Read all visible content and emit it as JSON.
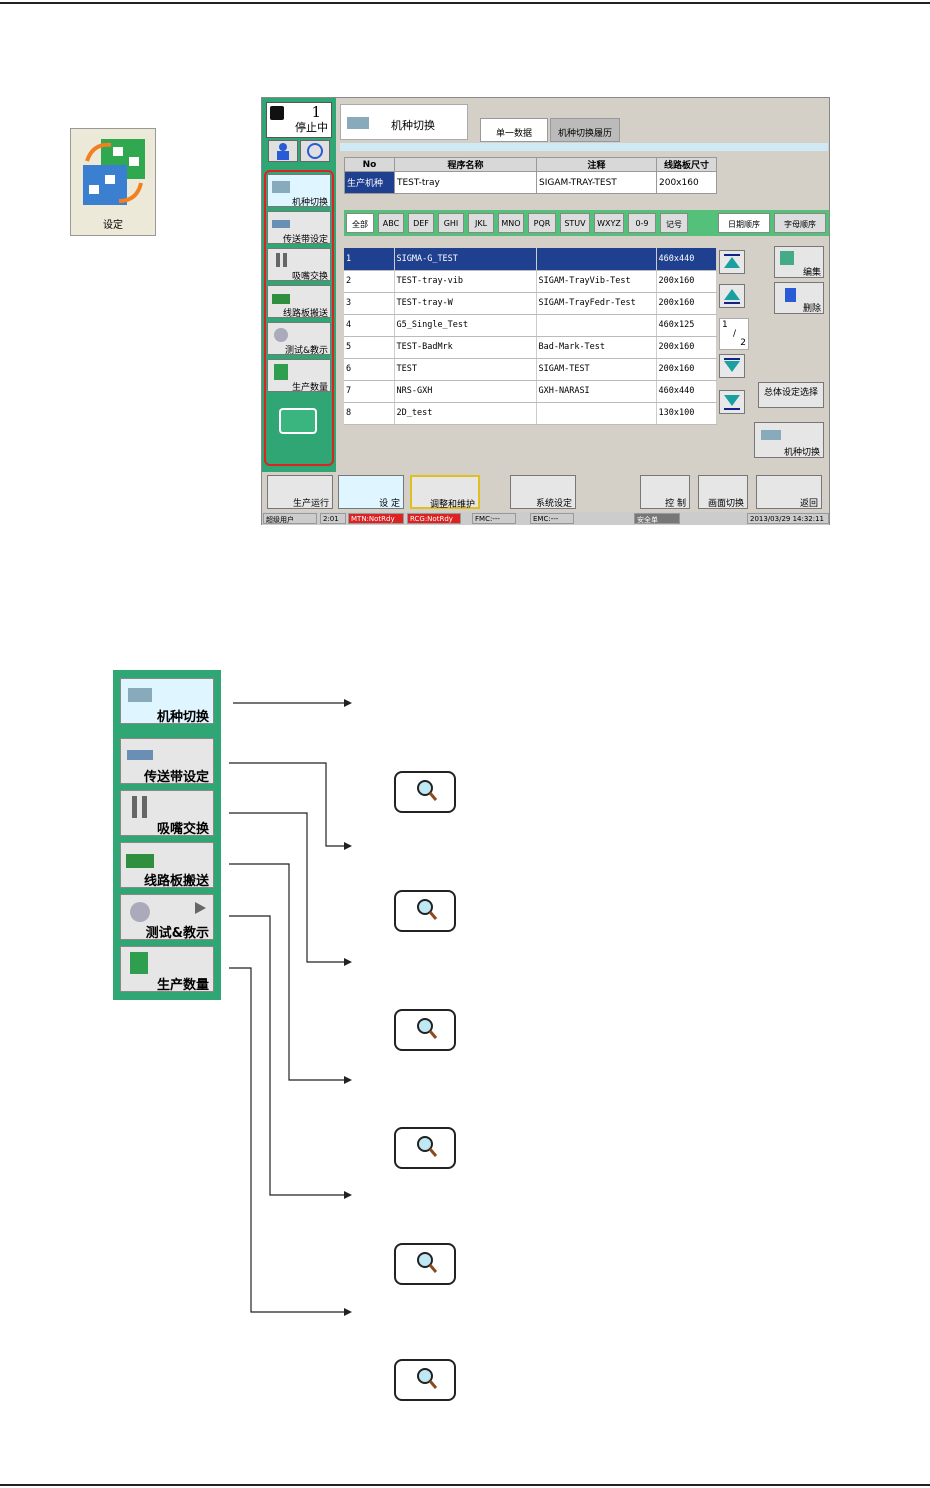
{
  "settings_icon": {
    "label": "设定"
  },
  "screen": {
    "status": {
      "count": "1",
      "text": "停止中"
    },
    "title": "机种切换",
    "tabs": [
      "单一数据",
      "机种切换履历"
    ],
    "sidebar": [
      "机种切换",
      "传送带设定",
      "吸嘴交换",
      "线路板搬送",
      "测试&教示",
      "生产数量"
    ],
    "header_table": {
      "columns": [
        "No",
        "程序名称",
        "注释",
        "线路板尺寸"
      ],
      "row": [
        "生产机种",
        "TEST-tray",
        "SIGAM-TRAY-TEST",
        "200x160"
      ]
    },
    "filters": [
      "全部",
      "ABC",
      "DEF",
      "GHI",
      "JKL",
      "MNO",
      "PQR",
      "STUV",
      "WXYZ",
      "0-9",
      "记号"
    ],
    "sort_buttons": [
      "日期顺序",
      "字母顺序"
    ],
    "list": [
      [
        "1",
        "SIGMA-G_TEST",
        "",
        "460x440"
      ],
      [
        "2",
        "TEST-tray-vib",
        "SIGAM-TrayVib-Test",
        "200x160"
      ],
      [
        "3",
        "TEST-tray-W",
        "SIGAM-TrayFedr-Test",
        "200x160"
      ],
      [
        "4",
        "G5_Single_Test",
        "",
        "460x125"
      ],
      [
        "5",
        "TEST-BadMrk",
        "Bad-Mark-Test",
        "200x160"
      ],
      [
        "6",
        "TEST",
        "SIGAM-TEST",
        "200x160"
      ],
      [
        "7",
        "NRS-GXH",
        "GXH-NARASI",
        "460x440"
      ],
      [
        "8",
        "2D_test",
        "",
        "130x100"
      ]
    ],
    "page": {
      "current": "1",
      "sep": "/",
      "total": "2"
    },
    "right_buttons": {
      "edit": "编集",
      "delete": "删除",
      "overall": "总体设定选择",
      "switch": "机种切换"
    },
    "bottom_buttons": [
      "生产运行",
      "设 定",
      "调整和维护",
      "系统设定",
      "控 制",
      "画面切换",
      "返回"
    ],
    "statusbar": [
      "超级用户",
      "2:01",
      "MTN:NotRdy",
      "RCG:NotRdy",
      "FMC:---",
      "EMC:---",
      "安全单",
      "2013/03/29 14:32:11"
    ]
  },
  "diagram": {
    "buttons": [
      "机种切换",
      "传送带设定",
      "吸嘴交换",
      "线路板搬送",
      "测试&教示",
      "生产数量"
    ]
  }
}
